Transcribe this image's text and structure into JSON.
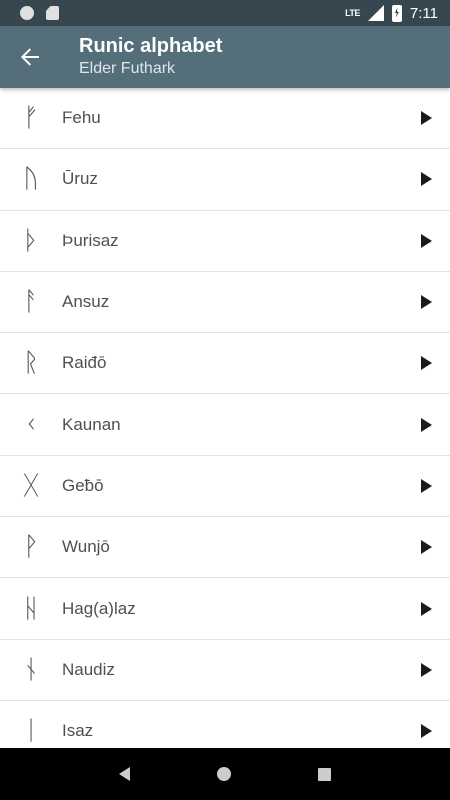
{
  "status_bar": {
    "time": "7:11",
    "network": "LTE",
    "icons": [
      "notification-dot-icon",
      "sd-card-icon",
      "signal-icon",
      "battery-charging-icon"
    ]
  },
  "app_bar": {
    "title": "Runic alphabet",
    "subtitle": "Elder Futhark",
    "back_icon": "arrow-left-icon"
  },
  "runes": [
    {
      "glyph": "ᚠ",
      "name": "Fehu"
    },
    {
      "glyph": "ᚢ",
      "name": "Ūruz"
    },
    {
      "glyph": "ᚦ",
      "name": "Þurisaz"
    },
    {
      "glyph": "ᚨ",
      "name": "Ansuz"
    },
    {
      "glyph": "ᚱ",
      "name": "Raiđō"
    },
    {
      "glyph": "ᚲ",
      "name": "Kaunan"
    },
    {
      "glyph": "ᚷ",
      "name": "Geƀō"
    },
    {
      "glyph": "ᚹ",
      "name": "Wunjō"
    },
    {
      "glyph": "ᚺ",
      "name": "Hag(a)laz"
    },
    {
      "glyph": "ᚾ",
      "name": "Naudiz"
    },
    {
      "glyph": "ᛁ",
      "name": "Isaz"
    }
  ],
  "colors": {
    "status_bar": "#37474f",
    "app_bar": "#546e7a",
    "divider": "#e3e3e3",
    "text": "#505050"
  },
  "nav_bar": {
    "icons": [
      "back-triangle-icon",
      "home-circle-icon",
      "recents-square-icon"
    ]
  }
}
